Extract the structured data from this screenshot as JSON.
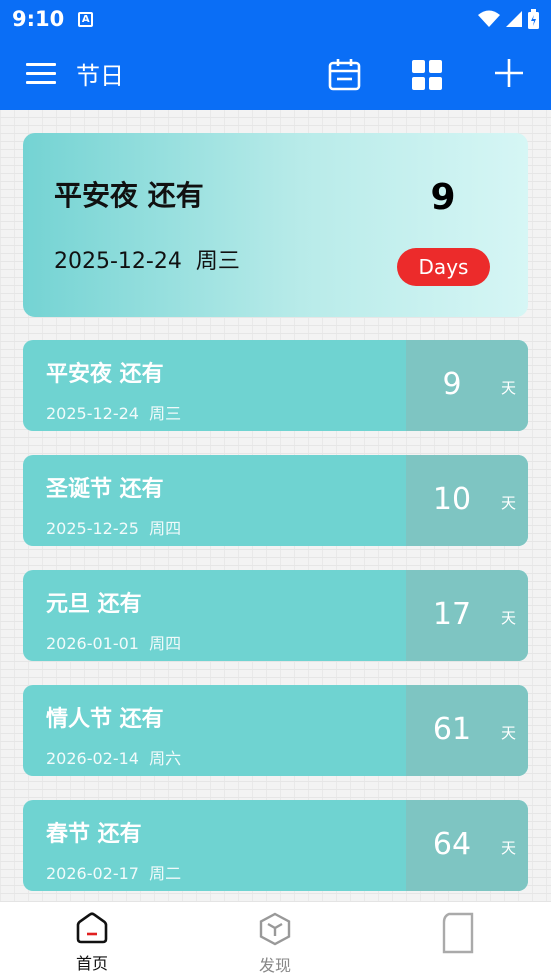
{
  "status": {
    "time": "9:10",
    "app_badge": "A"
  },
  "appbar": {
    "title": "节日"
  },
  "hero": {
    "title": "平安夜 还有",
    "date": "2025-12-24",
    "weekday": "周三",
    "count": "9",
    "unit": "Days"
  },
  "events": [
    {
      "title": "平安夜 还有",
      "date": "2025-12-24",
      "weekday": "周三",
      "count": "9",
      "unit": "天"
    },
    {
      "title": "圣诞节 还有",
      "date": "2025-12-25",
      "weekday": "周四",
      "count": "10",
      "unit": "天"
    },
    {
      "title": "元旦 还有",
      "date": "2026-01-01",
      "weekday": "周四",
      "count": "17",
      "unit": "天"
    },
    {
      "title": "情人节 还有",
      "date": "2026-02-14",
      "weekday": "周六",
      "count": "61",
      "unit": "天"
    },
    {
      "title": "春节 还有",
      "date": "2026-02-17",
      "weekday": "周二",
      "count": "64",
      "unit": "天"
    }
  ],
  "nav": {
    "home": "首页",
    "discover": "发现",
    "third": ""
  },
  "colors": {
    "primary": "#0a6ef6",
    "card": "#6fd3d1",
    "card_count_bg": "#7ec5c2",
    "badge": "#ec2b2b"
  }
}
